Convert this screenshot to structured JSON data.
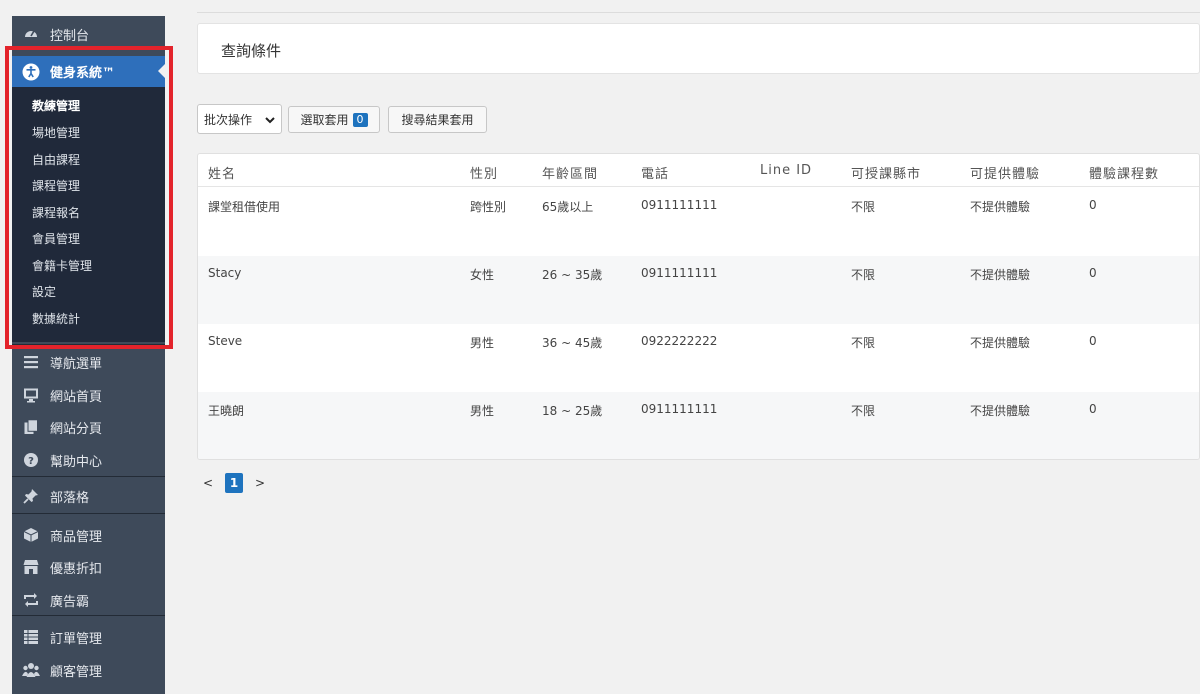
{
  "sidebar": {
    "top_item": "控制台",
    "active_item": "健身系統™",
    "submenu": [
      "教練管理",
      "場地管理",
      "自由課程",
      "課程管理",
      "課程報名",
      "會員管理",
      "會籍卡管理",
      "設定",
      "數據統計"
    ],
    "items": [
      {
        "label": "導航選單",
        "icon": "menu-icon"
      },
      {
        "label": "網站首頁",
        "icon": "monitor-icon"
      },
      {
        "label": "網站分頁",
        "icon": "pages-icon"
      },
      {
        "label": "幫助中心",
        "icon": "help-icon"
      },
      {
        "label": "部落格",
        "icon": "pin-icon"
      },
      {
        "label": "商品管理",
        "icon": "box-icon"
      },
      {
        "label": "優惠折扣",
        "icon": "store-icon"
      },
      {
        "label": "廣告霸",
        "icon": "repeat-icon"
      },
      {
        "label": "訂單管理",
        "icon": "list-icon"
      },
      {
        "label": "顧客管理",
        "icon": "users-icon"
      }
    ]
  },
  "query": {
    "title": "查詢條件"
  },
  "toolbar": {
    "batch_label": "批次操作",
    "apply_selected_label": "選取套用",
    "selected_count": "0",
    "apply_results_label": "搜尋結果套用"
  },
  "table": {
    "headers": [
      "姓名",
      "性別",
      "年齡區間",
      "電話",
      "Line ID",
      "可授課縣市",
      "可提供體驗",
      "體驗課程數"
    ],
    "rows": [
      [
        "課堂租借使用",
        "跨性別",
        "65歲以上",
        "0911111111",
        "",
        "不限",
        "不提供體驗",
        "0"
      ],
      [
        "Stacy",
        "女性",
        "26 ~ 35歲",
        "0911111111",
        "",
        "不限",
        "不提供體驗",
        "0"
      ],
      [
        "Steve",
        "男性",
        "36 ~ 45歲",
        "0922222222",
        "",
        "不限",
        "不提供體驗",
        "0"
      ],
      [
        "王曉朗",
        "男性",
        "18 ~ 25歲",
        "0911111111",
        "",
        "不限",
        "不提供體驗",
        "0"
      ]
    ]
  },
  "pagination": {
    "prev": "<",
    "current": "1",
    "next": ">"
  },
  "colors": {
    "sidebar": "#3e4a5a",
    "active": "#2e6fbb",
    "submenu": "#20293a",
    "highlight": "#e3232b",
    "accent": "#1e73be"
  }
}
